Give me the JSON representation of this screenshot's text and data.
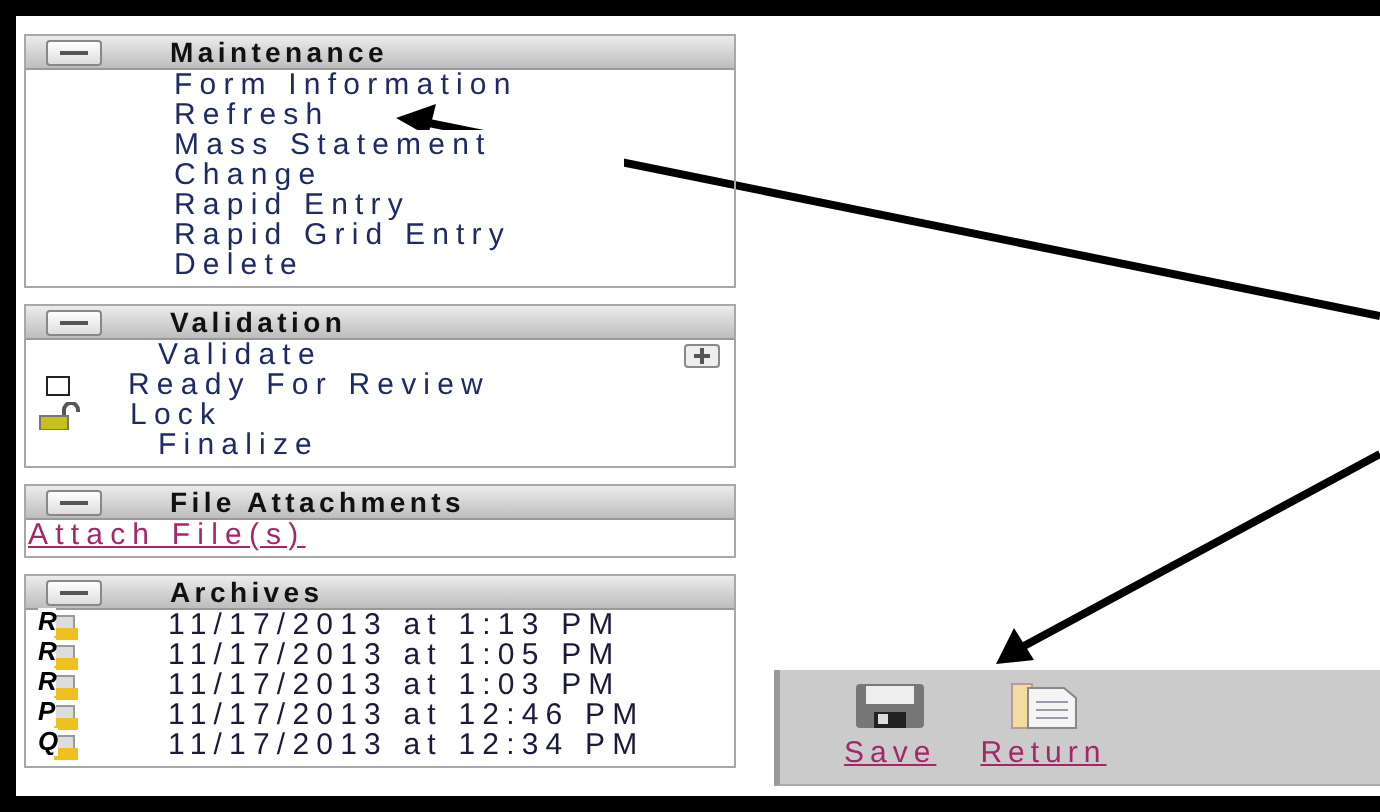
{
  "panels": [
    {
      "title": "Maintenance",
      "expanded": true,
      "items": [
        {
          "kind": "menu",
          "label": "Form Information"
        },
        {
          "kind": "menu",
          "label": "Refresh"
        },
        {
          "kind": "menu",
          "label": "Mass Statement Change"
        },
        {
          "kind": "menu",
          "label": "Rapid Entry"
        },
        {
          "kind": "menu",
          "label": "Rapid Grid Entry"
        },
        {
          "kind": "menu",
          "label": "Delete"
        }
      ]
    },
    {
      "title": "Validation",
      "expanded": true,
      "items": [
        {
          "kind": "action",
          "label": "Validate"
        },
        {
          "kind": "checkbox",
          "label": "Ready For Review",
          "checked": false
        },
        {
          "kind": "lock",
          "label": "Lock",
          "locked": false
        },
        {
          "kind": "plain",
          "label": "Finalize"
        }
      ]
    },
    {
      "title": "File Attachments",
      "expanded": true,
      "items": [
        {
          "kind": "attach",
          "label": "Attach File(s)"
        }
      ]
    },
    {
      "title": "Archives",
      "expanded": true,
      "items": [
        {
          "kind": "archive",
          "icon_letter": "R",
          "label": "11/17/2013 at 1:13 PM"
        },
        {
          "kind": "archive",
          "icon_letter": "R",
          "label": "11/17/2013 at 1:05 PM"
        },
        {
          "kind": "archive",
          "icon_letter": "R",
          "label": "11/17/2013 at 1:03 PM"
        },
        {
          "kind": "archive",
          "icon_letter": "P",
          "label": "11/17/2013 at 12:46 PM"
        },
        {
          "kind": "archive",
          "icon_letter": "Q",
          "label": "11/17/2013 at 12:34 PM"
        }
      ]
    }
  ],
  "toolbar": [
    {
      "kind": "save",
      "label": "Save"
    },
    {
      "kind": "return",
      "label": "Return"
    }
  ]
}
